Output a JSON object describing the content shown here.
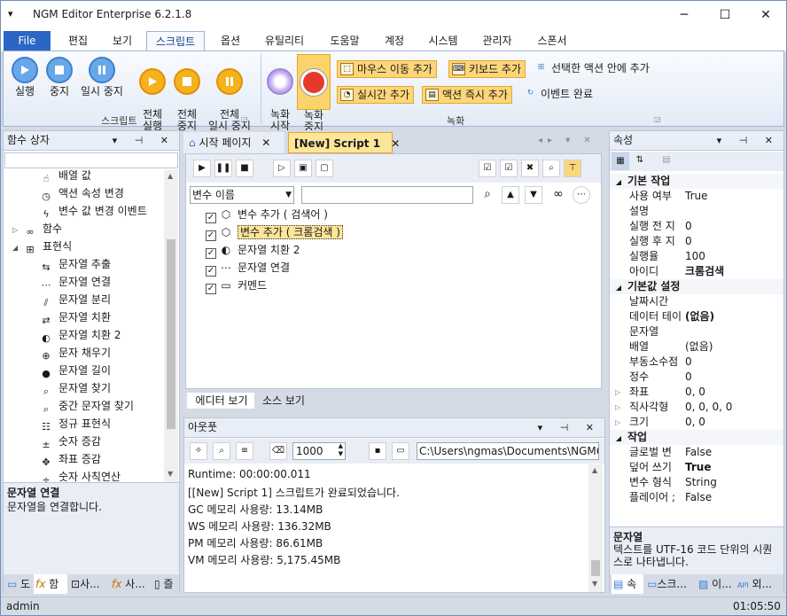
{
  "window": {
    "title": "NGM Editor  Enterprise 6.2.1.8",
    "menu_glyph": "▾",
    "minimize": "─",
    "maximize": "☐",
    "close": "✕"
  },
  "ribbon_tabs": [
    "File",
    "편집",
    "보기",
    "스크립트",
    "옵션",
    "유틸리티",
    "도움말",
    "계정",
    "시스템",
    "관리자",
    "스폰서"
  ],
  "ribbon": {
    "group_script": "스크립트",
    "group_record": "녹화",
    "btn_run": "실행",
    "btn_stop": "중지",
    "btn_pause": "일시 중지",
    "btn_run_all": "전체\n실행",
    "btn_stop_all": "전체\n중지",
    "btn_pause_all": "전체\n일시 중지",
    "btn_record_start": "녹화\n시작",
    "btn_record_stop": "녹화\n중지",
    "btn_mouse_move": "마우스 이동 추가",
    "btn_keyboard": "키보드 추가",
    "btn_selected_action": "선택한 액션 안에 추가",
    "btn_realtime": "실시간 추가",
    "btn_action_now": "액션 즉시 추가",
    "btn_event_done": "이벤트 완료"
  },
  "left_panel": {
    "title": "함수 상자",
    "items": [
      {
        "label": "배열 값",
        "icon": "pointer-icon"
      },
      {
        "label": "액션 속성 변경",
        "icon": "clock-icon"
      },
      {
        "label": "변수 값 변경 이벤트",
        "icon": "bolt-icon"
      },
      {
        "label": "함수",
        "icon": "infinity-icon",
        "group": true
      },
      {
        "label": "표현식",
        "icon": "grid-icon",
        "group": true,
        "expanded": true
      },
      {
        "label": "문자열 추출",
        "icon": "extract-icon"
      },
      {
        "label": "문자열 연결",
        "icon": "dots-icon"
      },
      {
        "label": "문자열 분리",
        "icon": "split-icon"
      },
      {
        "label": "문자열 치환",
        "icon": "replace-icon"
      },
      {
        "label": "문자열 치환 2",
        "icon": "toggle-icon"
      },
      {
        "label": "문자 채우기",
        "icon": "fill-icon"
      },
      {
        "label": "문자열 길이",
        "icon": "length-icon"
      },
      {
        "label": "문자열 찾기",
        "icon": "search-icon"
      },
      {
        "label": "중간 문자열 찾기",
        "icon": "search-icon"
      },
      {
        "label": "정규 표현식",
        "icon": "regex-icon"
      },
      {
        "label": "숫자 증감",
        "icon": "plusminus-icon"
      },
      {
        "label": "좌표 증감",
        "icon": "coordinate-icon"
      },
      {
        "label": "숫자 사칙연산",
        "icon": "calc-icon"
      }
    ],
    "desc_title": "문자열 연결",
    "desc_text": "문자열을 연결합니다.",
    "tabs": [
      "도",
      "함",
      "사...",
      "사...",
      "즐"
    ]
  },
  "doc_tabs": [
    {
      "label": "시작 페이지",
      "active": false
    },
    {
      "label": "[New] Script 1",
      "active": true
    }
  ],
  "editor": {
    "var_select": "변수 이름",
    "search_value": "",
    "items": [
      {
        "label": "변수 추가 ( 검색어 )",
        "checked": true,
        "selected": false
      },
      {
        "label": "변수 추가 ( 크롬검색 )",
        "checked": true,
        "selected": true
      },
      {
        "label": "문자열 치환 2",
        "checked": true,
        "selected": false
      },
      {
        "label": "문자열 연결",
        "checked": true,
        "selected": false
      },
      {
        "label": "커멘드",
        "checked": true,
        "selected": false
      }
    ],
    "bottom_tabs": [
      "에디터 보기",
      "소스 보기"
    ]
  },
  "output": {
    "title": "아웃풋",
    "count": "1000",
    "path": "C:\\Users\\ngmas\\Documents\\NGM6\\",
    "lines": [
      "Runtime: 00:00:00.011",
      "[[New] Script 1] 스크립트가 완료되었습니다.",
      "GC 메모리 사용량: 13.14MB",
      "WS 메모리 사용량: 136.32MB",
      "PM 메모리 사용량: 86.61MB",
      "VM 메모리 사용량: 5,175.45MB"
    ]
  },
  "properties": {
    "title": "속성",
    "categories": [
      {
        "name": "기본 작업",
        "rows": [
          {
            "name": "사용 여부",
            "value": "True"
          },
          {
            "name": "설명",
            "value": ""
          },
          {
            "name": "실행 전 지",
            "value": "0"
          },
          {
            "name": "실행 후 지",
            "value": "0"
          },
          {
            "name": "실행율",
            "value": "100"
          },
          {
            "name": "아이디",
            "value": "크롬검색",
            "bold": true
          }
        ]
      },
      {
        "name": "기본값 설정",
        "rows": [
          {
            "name": "날짜시간",
            "value": ""
          },
          {
            "name": "데이터 테이",
            "value": "(없음)",
            "bold": true
          },
          {
            "name": "문자열",
            "value": ""
          },
          {
            "name": "배열",
            "value": "(없음)"
          },
          {
            "name": "부동소수점",
            "value": "0"
          },
          {
            "name": "정수",
            "value": "0"
          },
          {
            "name": "좌표",
            "value": "0, 0",
            "exp": true
          },
          {
            "name": "직사각형",
            "value": "0, 0, 0, 0",
            "exp": true
          },
          {
            "name": "크기",
            "value": "0, 0",
            "exp": true
          }
        ]
      },
      {
        "name": "작업",
        "rows": [
          {
            "name": "글로벌 변",
            "value": "False"
          },
          {
            "name": "덮어 쓰기",
            "value": "True",
            "bold": true
          },
          {
            "name": "변수 형식",
            "value": "String"
          },
          {
            "name": "플레이어 ;",
            "value": "False"
          }
        ]
      }
    ],
    "desc_title": "문자열",
    "desc_text": "텍스트를 UTF-16 코드 단위의 시퀀스로 나타냅니다.",
    "tabs": [
      "속",
      "스크...",
      "이...",
      "외..."
    ]
  },
  "status": {
    "user": "admin",
    "time": "01:05:50"
  }
}
